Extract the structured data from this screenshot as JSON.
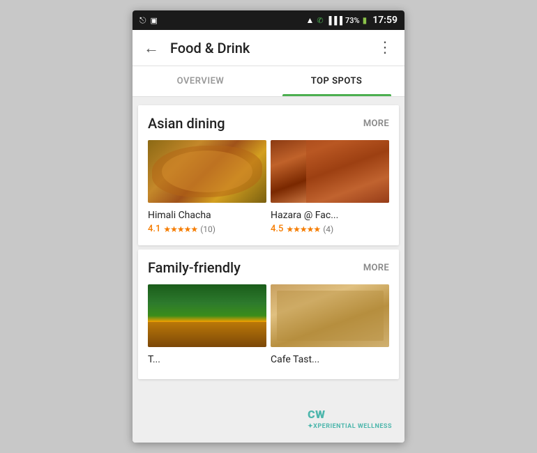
{
  "status_bar": {
    "time": "17:59",
    "battery": "73%",
    "icons_left": [
      "usb-icon",
      "image-icon"
    ],
    "icons_right": [
      "wifi-icon",
      "phone-icon",
      "signal-icon",
      "battery-icon"
    ]
  },
  "top_bar": {
    "back_label": "←",
    "title": "Food & Drink",
    "menu_label": "⋮"
  },
  "tabs": [
    {
      "id": "overview",
      "label": "OVERVIEW",
      "active": false
    },
    {
      "id": "top-spots",
      "label": "TOP SPOTS",
      "active": true
    }
  ],
  "cards": [
    {
      "id": "asian-dining",
      "title": "Asian dining",
      "more_label": "MORE",
      "places": [
        {
          "id": "himali-chacha",
          "name": "Himali Chacha",
          "rating": "4.1",
          "stars": "★★★★★",
          "review_count": "(10)",
          "img_type": "food"
        },
        {
          "id": "hazara",
          "name": "Hazara @ Fac...",
          "rating": "4.5",
          "stars": "★★★★★",
          "review_count": "(4)",
          "img_type": "restaurant"
        }
      ]
    },
    {
      "id": "family-friendly",
      "title": "Family-friendly",
      "more_label": "MORE",
      "places": [
        {
          "id": "place3",
          "name": "T...",
          "rating": "",
          "stars": "",
          "review_count": "",
          "img_type": "outdoor"
        },
        {
          "id": "cafe-taste",
          "name": "Cafe Tast...",
          "rating": "",
          "stars": "",
          "review_count": "",
          "img_type": "interior"
        }
      ]
    }
  ],
  "watermark": {
    "symbol": "CW",
    "text": "XPERIENTIAL WELLNESS"
  }
}
